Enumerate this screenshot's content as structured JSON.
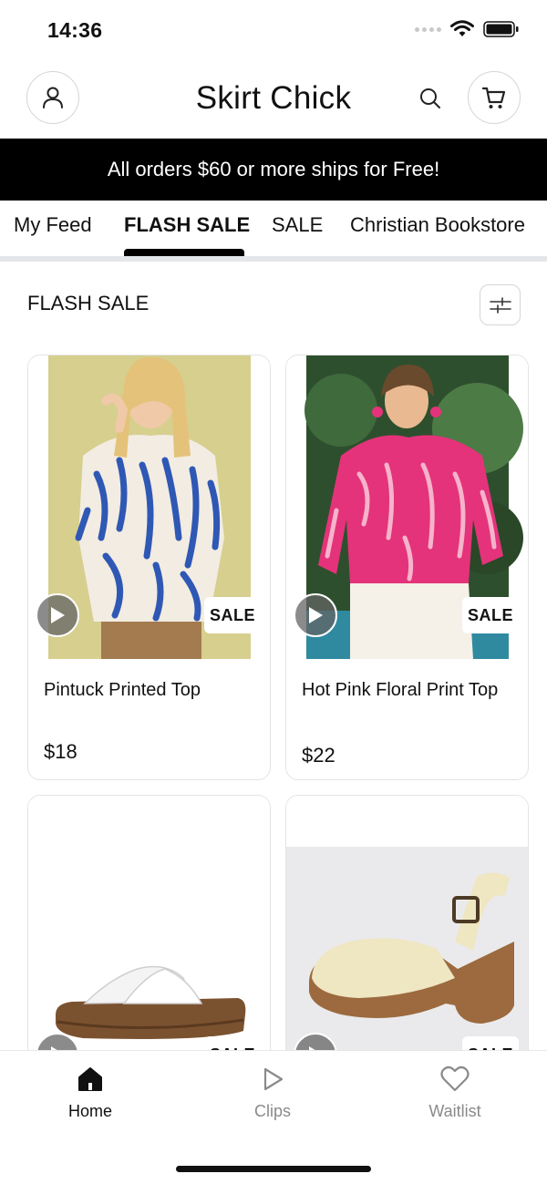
{
  "status_bar": {
    "time": "14:36"
  },
  "header": {
    "title": "Skirt Chick"
  },
  "promo": {
    "text": "All orders $60 or more ships for Free!"
  },
  "tabs": [
    {
      "label": "My Feed",
      "active": false
    },
    {
      "label": "FLASH SALE",
      "active": true
    },
    {
      "label": "SALE",
      "active": false
    },
    {
      "label": "Christian Bookstore",
      "active": false
    }
  ],
  "section": {
    "title": "FLASH SALE"
  },
  "products": [
    {
      "name": "Pintuck Printed Top",
      "price": "$18",
      "badge": "SALE"
    },
    {
      "name": "Hot Pink Floral Print Top",
      "price": "$22",
      "badge": "SALE"
    },
    {
      "badge": "SALE"
    },
    {
      "badge": "SALE"
    }
  ],
  "bottom_nav": [
    {
      "label": "Home",
      "icon": "home-icon",
      "active": true
    },
    {
      "label": "Clips",
      "icon": "play-icon",
      "active": false
    },
    {
      "label": "Waitlist",
      "icon": "heart-icon",
      "active": false
    }
  ],
  "colors": {
    "promo_bg": "#000000",
    "accent": "#000000",
    "inactive": "#8a8a8a",
    "divider": "#e4e7ea"
  }
}
